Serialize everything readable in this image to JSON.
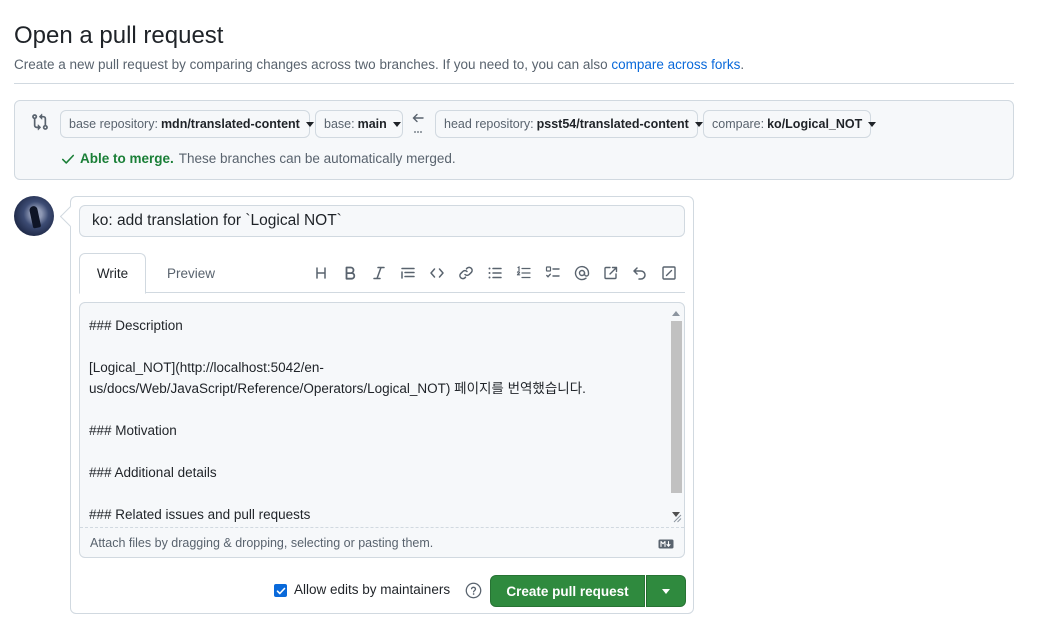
{
  "header": {
    "title": "Open a pull request",
    "subtitle": "Create a new pull request by comparing changes across two branches. If you need to, you can also ",
    "subtitle_link": "compare across forks",
    "subtitle_end": "."
  },
  "range": {
    "base_repo_prefix": "base repository:",
    "base_repo": "mdn/translated-content",
    "base_prefix": "base:",
    "base_branch": "main",
    "head_repo_prefix": "head repository:",
    "head_repo": "psst54/translated-content",
    "compare_prefix": "compare:",
    "compare_branch": "ko/Logical_NOT",
    "merge_ok": "Able to merge.",
    "merge_message": "These branches can be automatically merged."
  },
  "form": {
    "title_value": "ko: add translation for `Logical NOT`",
    "tabs": {
      "write": "Write",
      "preview": "Preview"
    },
    "toolbar_icons": [
      "heading-icon",
      "bold-icon",
      "italic-icon",
      "quote-icon",
      "code-icon",
      "link-icon",
      "unordered-list-icon",
      "ordered-list-icon",
      "task-list-icon",
      "mention-icon",
      "reference-icon",
      "undo-icon",
      "fullscreen-icon"
    ],
    "body": "### Description\n\n[Logical_NOT](http://localhost:5042/en-\nus/docs/Web/JavaScript/Reference/Operators/Logical_NOT) 페이지를 번역했습니다.\n\n### Motivation\n\n### Additional details\n\n### Related issues and pull requests",
    "attach_hint": "Attach files by dragging & dropping, selecting or pasting them.",
    "allow_edits_label": "Allow edits by maintainers",
    "allow_edits_checked": true,
    "create_button": "Create pull request"
  },
  "colors": {
    "accent": "#0969da",
    "success": "#1a7f37",
    "primary_button": "#2f8a3e"
  }
}
